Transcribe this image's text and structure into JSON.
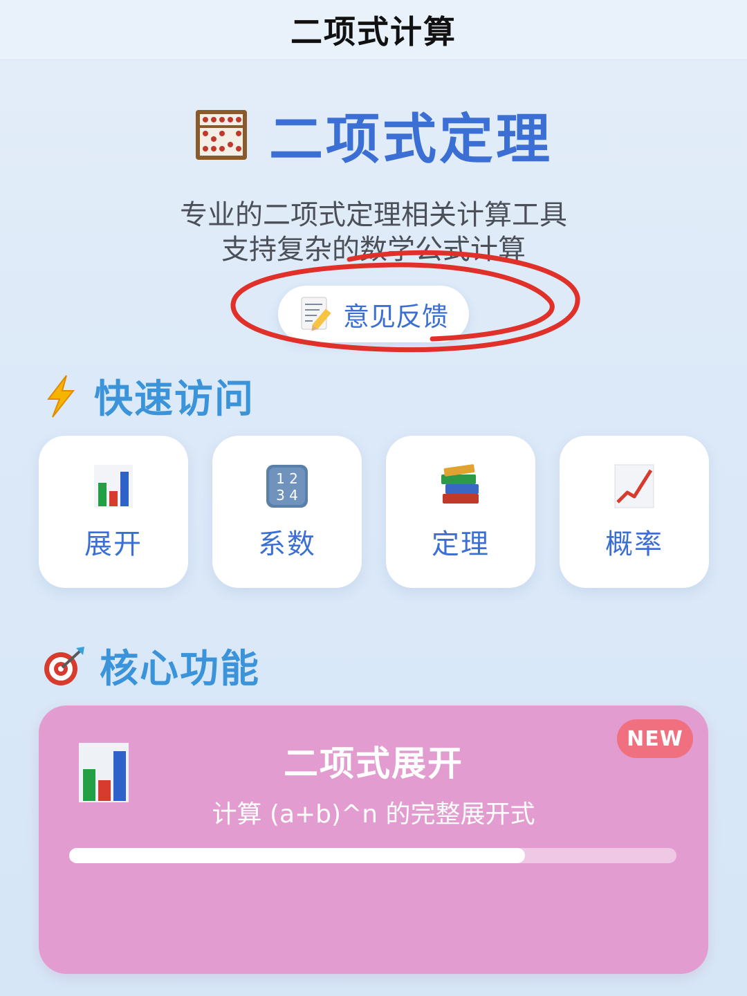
{
  "nav": {
    "title": "二项式计算"
  },
  "hero": {
    "icon": "abacus-icon",
    "title": "二项式定理",
    "subtitle_line1": "专业的二项式定理相关计算工具",
    "subtitle_line2": "支持复杂的数学公式计算"
  },
  "feedback": {
    "icon": "memo-icon",
    "label": "意见反馈",
    "annotation_color": "#e0302a"
  },
  "quick_access": {
    "icon": "lightning-icon",
    "title": "快速访问",
    "items": [
      {
        "icon": "bar-chart-icon",
        "label": "展开"
      },
      {
        "icon": "number-keycap-icon",
        "label": "系数"
      },
      {
        "icon": "books-icon",
        "label": "定理"
      },
      {
        "icon": "trend-chart-icon",
        "label": "概率"
      }
    ]
  },
  "core_features": {
    "icon": "target-icon",
    "title": "核心功能",
    "cards": [
      {
        "icon": "bar-chart-icon",
        "title": "二项式展开",
        "description": "计算 (a+b)^n 的完整展开式",
        "badge": "NEW",
        "progress": 0.75,
        "card_color": "#e29ccf",
        "badge_color": "#f07080"
      }
    ]
  },
  "colors": {
    "accent": "#3b6fd4",
    "section_title": "#3b93d9"
  }
}
